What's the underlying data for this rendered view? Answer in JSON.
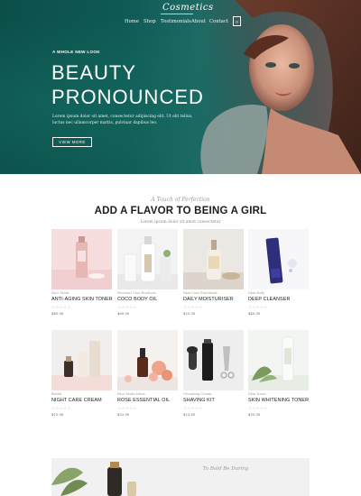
{
  "nav": {
    "logo": "Cosmetics",
    "links": [
      "Home",
      "Shop",
      "Testimonials",
      "About",
      "Contact"
    ],
    "cart_count": "0"
  },
  "hero": {
    "kicker": "A WHOLE NEW LOOK",
    "title_line1": "BEAUTY",
    "title_line2": "PRONOUNCED",
    "text": "Lorem ipsum dolor sit amet, consectetur adipiscing elit. Ut elit tellus, luctus nec ullamcorper mattis, pulvinar dapibus leo.",
    "button": "VIEW MORE"
  },
  "section": {
    "script": "A Touch of Perfection",
    "title": "ADD A FLAVOR TO BEING A GIRL",
    "subtitle": "Lorem ipsum dolor sit amet consectetur"
  },
  "products": [
    {
      "category": "Face Make",
      "name": "ANTI-AGING SKIN TONER",
      "stars": "☆☆☆☆☆",
      "price": "$40.00"
    },
    {
      "category": "Personal Care Products",
      "name": "COCO BODY OIL",
      "stars": "☆☆☆☆☆",
      "price": "$60.00"
    },
    {
      "category": "Skin Care Essentials",
      "name": "DAILY MOISTURISER",
      "stars": "☆☆☆☆☆",
      "price": "$25.00"
    },
    {
      "category": "Skin Body",
      "name": "DEEP CLEANSER",
      "stars": "☆☆☆☆☆",
      "price": "$40.00"
    },
    {
      "category": "Bridal",
      "name": "NIGHT CARE CREAM",
      "stars": "☆☆☆☆☆",
      "price": "$15.00"
    },
    {
      "category": "Face Make Ideas",
      "name": "ROSE ESSENTIAL OIL",
      "stars": "☆☆☆☆☆",
      "price": "$32.00"
    },
    {
      "category": "Grooming Cream",
      "name": "SHAVING KIT",
      "stars": "☆☆☆☆☆",
      "price": "$23.00"
    },
    {
      "category": "Skin Toner",
      "name": "SKIN WHITENING TONER",
      "stars": "☆☆☆☆☆",
      "price": "$35.00"
    }
  ],
  "banner": {
    "script": "To Bold Be Daring"
  },
  "colors": {
    "hero_teal": "#0f5a54",
    "text_dark": "#1c1c1c"
  }
}
